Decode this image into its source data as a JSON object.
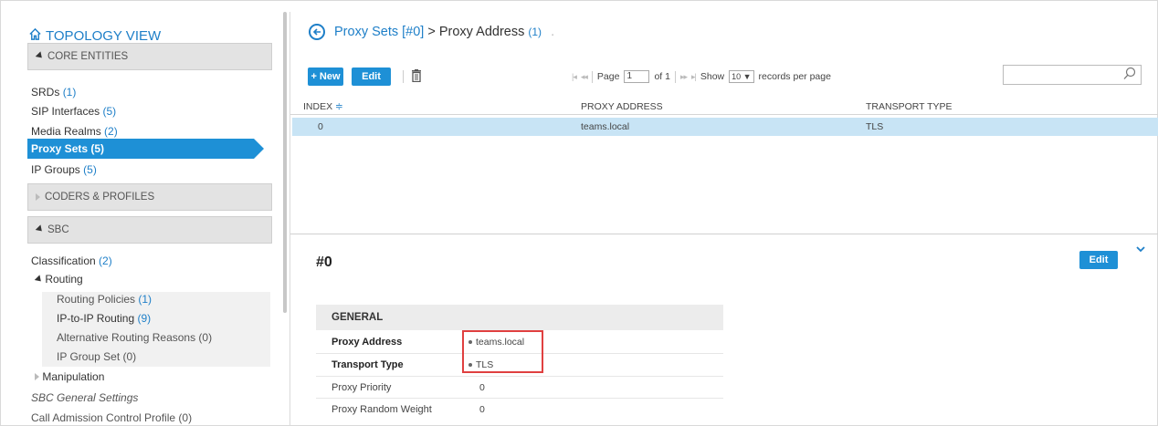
{
  "sidebar": {
    "title": "TOPOLOGY VIEW",
    "sections": {
      "core": "CORE ENTITIES",
      "coders": "CODERS & PROFILES",
      "sbc": "SBC"
    },
    "core_items": [
      {
        "label": "SRDs",
        "count": "(1)"
      },
      {
        "label": "SIP Interfaces",
        "count": "(5)"
      },
      {
        "label": "Media Realms",
        "count": "(2)"
      },
      {
        "label": "Proxy Sets (5)",
        "count": ""
      },
      {
        "label": "IP Groups",
        "count": "(5)"
      }
    ],
    "sbc_items": {
      "classification": {
        "label": "Classification",
        "count": "(2)"
      },
      "routing": "Routing",
      "routing_policies": {
        "label": "Routing Policies",
        "count": "(1)"
      },
      "ip_to_ip": {
        "label": "IP-to-IP Routing",
        "count": "(9)"
      },
      "alt_routing": "Alternative Routing Reasons (0)",
      "ip_group_set": "IP Group Set (0)",
      "manipulation": "Manipulation",
      "sbc_general": "SBC General Settings",
      "cac_profile": "Call Admission Control Profile (0)"
    }
  },
  "header": {
    "parent": "Proxy Sets [#0]",
    "separator": ">",
    "current": "Proxy Address",
    "count": "(1)",
    "dot": "."
  },
  "toolbar": {
    "new_label": "+ New",
    "edit_label": "Edit"
  },
  "pager": {
    "page_label": "Page",
    "page_value": "1",
    "of_label": "of 1",
    "show_label": "Show",
    "show_value": "10 ▼",
    "per_page_label": "records per page"
  },
  "search": {
    "value": ""
  },
  "table": {
    "columns": [
      "INDEX",
      "PROXY ADDRESS",
      "TRANSPORT TYPE"
    ],
    "rows": [
      {
        "index": "0",
        "proxy_address": "teams.local",
        "transport_type": "TLS"
      }
    ]
  },
  "detail": {
    "title": "#0",
    "edit_label": "Edit",
    "section": "GENERAL",
    "fields": [
      {
        "label": "Proxy Address",
        "value": "teams.local"
      },
      {
        "label": "Transport Type",
        "value": "TLS"
      },
      {
        "label": "Proxy Priority",
        "value": "0"
      },
      {
        "label": "Proxy Random Weight",
        "value": "0"
      }
    ]
  },
  "colors": {
    "accent": "#1e90d6",
    "link": "#1e7fc8",
    "selected_row": "#c8e4f5",
    "highlight_box": "#e04040"
  }
}
